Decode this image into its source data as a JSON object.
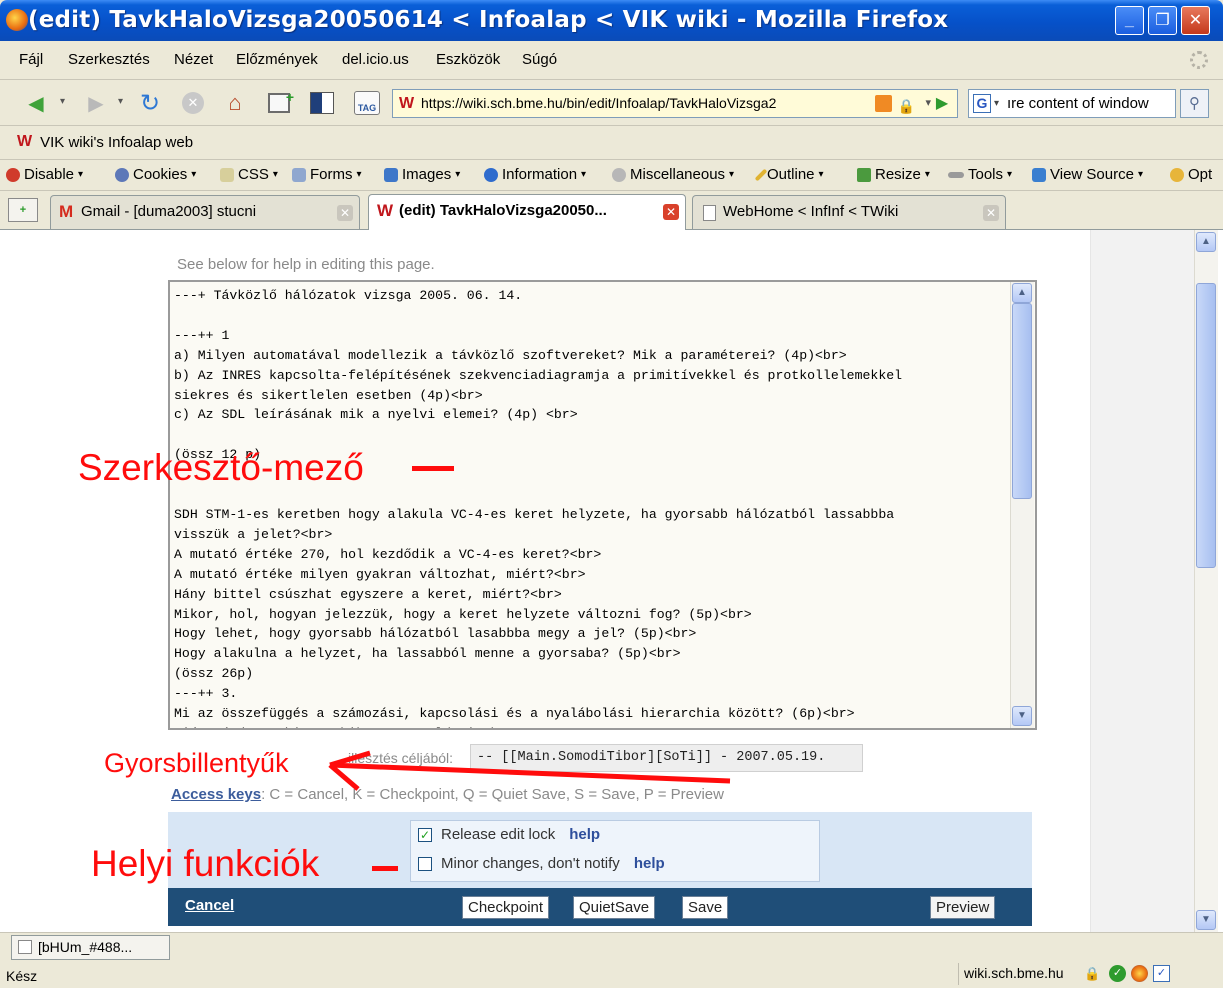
{
  "window": {
    "title": "(edit) TavkHaloVizsga20050614 < Infoalap < VIK wiki - Mozilla Firefox"
  },
  "menubar": {
    "items": [
      {
        "label": "Fájl"
      },
      {
        "label": "Szerkesztés"
      },
      {
        "label": "Nézet"
      },
      {
        "label": "Előzmények"
      },
      {
        "label": "del.icio.us"
      },
      {
        "label": "Eszközök"
      },
      {
        "label": "Súgó"
      }
    ]
  },
  "navbar": {
    "url": "https://wiki.sch.bme.hu/bin/edit/Infoalap/TavkHaloVizsga2",
    "search_value": "ıre content of window",
    "search_engine_letter": "G"
  },
  "bookmarks": {
    "item_label": "VIK wiki's Infoalap web"
  },
  "devbar": {
    "items": [
      {
        "label": "Disable",
        "icon": "disable-icon",
        "color": "#d03b2b"
      },
      {
        "label": "Cookies",
        "icon": "cookies-icon",
        "color": "#5d78b8"
      },
      {
        "label": "CSS",
        "icon": "css-icon",
        "color": "#d7cf9b"
      },
      {
        "label": "Forms",
        "icon": "forms-icon",
        "color": "#8fa7cf"
      },
      {
        "label": "Images",
        "icon": "images-icon",
        "color": "#3e77c9"
      },
      {
        "label": "Information",
        "icon": "information-icon",
        "color": "#2f6ccd"
      },
      {
        "label": "Miscellaneous",
        "icon": "miscellaneous-icon",
        "color": "#b7b7b7"
      },
      {
        "label": "Outline",
        "icon": "outline-icon",
        "color": "#e0b332"
      },
      {
        "label": "Resize",
        "icon": "resize-icon",
        "color": "#4b9a3e"
      },
      {
        "label": "Tools",
        "icon": "tools-icon",
        "color": "#9a9a9a"
      },
      {
        "label": "View Source",
        "icon": "view-source-icon",
        "color": "#3a7fd0"
      },
      {
        "label": "Opt",
        "icon": "options-icon",
        "color": "#e7b53a"
      }
    ]
  },
  "tabs": [
    {
      "label": "Gmail - [duma2003] stucni",
      "active": false
    },
    {
      "label": "(edit) TavkHaloVizsga20050...",
      "active": true
    },
    {
      "label": "WebHome < InfInf < TWiki",
      "active": false
    }
  ],
  "page": {
    "help_text": "See below for help in editing this page.",
    "editor_lines": [
      "---+ Távközlő hálózatok vizsga 2005. 06. 14.",
      "",
      "---++ 1",
      "a) Milyen automatával modellezik a távközlő szoftvereket? Mik a paraméterei? (4p)<br>",
      "b) Az INRES kapcsolta-felépítésének szekvenciadiagramja a primitívekkel és protkollelemekkel",
      "siekres és sikertlelen esetben (4p)<br>",
      "c) Az SDL leírásának mik a nyelvi elemei? (4p) <br>",
      "",
      "(össz 12 p)",
      "",
      "",
      "SDH STM-1-es keretben hogy alakula VC-4-es keret helyzete, ha gyorsabb hálózatból lassabbba",
      "visszük a jelet?<br>",
      "A mutató értéke 270, hol kezdődik a VC-4-es keret?<br>",
      "A mutató értéke milyen gyakran változhat, miért?<br>",
      "Hány bittel csúszhat egyszere a keret, miért?<br>",
      "Mikor, hol, hogyan jelezzük, hogy a keret helyzete változni fog? (5p)<br>",
      "Hogy lehet, hogy gyorsabb hálózatból lasabbba megy a jel? (5p)<br>",
      "Hogy alakulna a helyzet, ha lassabból menne a gyorsaba? (5p)<br>",
      "(össz 26p)",
      "---++ 3.",
      "Mi az összefüggés a számozási, kapcsolási és a nyalábolási hierarchia között? (6p)<br>",
      "Miért érdemes hierarchikusan megoldani?<br>"
    ],
    "signature_label": "illesztés céljából:",
    "signature_value": "-- [[Main.SomodiTibor][SoTi]] - 2007.05.19.",
    "access_keys_label": "Access keys",
    "access_keys_text": ": C = Cancel, K = Checkpoint, Q = Quiet Save, S = Save, P = Preview",
    "options": [
      {
        "label": "Release edit lock",
        "checked": true,
        "help": "help"
      },
      {
        "label": "Minor changes, don't notify",
        "checked": false,
        "help": "help"
      }
    ],
    "buttons": {
      "cancel": "Cancel",
      "checkpoint": "Checkpoint",
      "quietsave": "QuietSave",
      "save": "Save",
      "preview": "Preview"
    }
  },
  "annotations": {
    "editor_field": "Szerkesztő-mező",
    "shortcuts": "Gyorsbillentyűk",
    "local_functions": "Helyi funkciók"
  },
  "statusbar": {
    "download_tab": "[bHUm_#488...",
    "status": "Kész",
    "domain": "wiki.sch.bme.hu"
  }
}
